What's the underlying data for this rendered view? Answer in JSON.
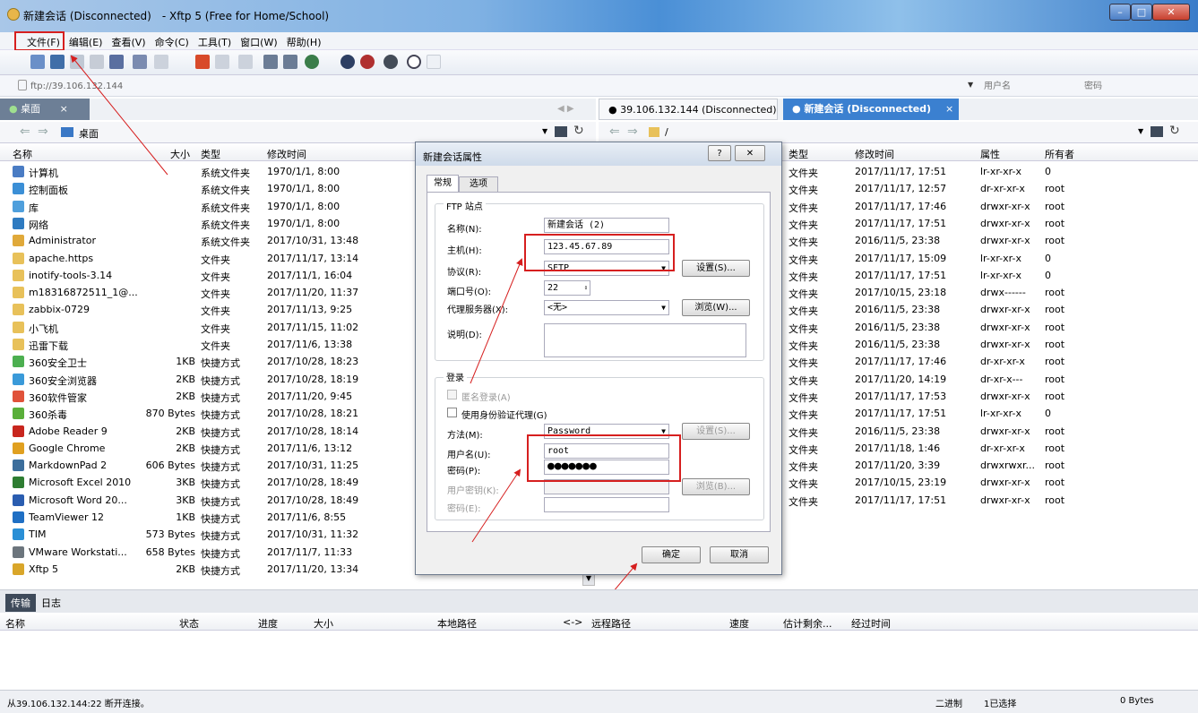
{
  "window": {
    "title": "新建会话 (Disconnected)　- Xftp 5 (Free for Home/School)",
    "min": "–",
    "max": "□",
    "close": "✕"
  },
  "menu": [
    "文件(F)",
    "编辑(E)",
    "查看(V)",
    "命令(C)",
    "工具(T)",
    "窗口(W)",
    "帮助(H)"
  ],
  "address": {
    "value": "ftp://39.106.132.144",
    "user_placeholder": "用户名",
    "pass_placeholder": "密码"
  },
  "left": {
    "tab": "桌面",
    "tab_close": "×",
    "path": "桌面",
    "columns": [
      "名称",
      "大小",
      "类型",
      "修改时间"
    ],
    "rows": [
      {
        "name": "计算机",
        "size": "",
        "type": "系统文件夹",
        "date": "1970/1/1, 8:00",
        "icon": "computer-icon",
        "color": "#4a7cc4"
      },
      {
        "name": "控制面板",
        "size": "",
        "type": "系统文件夹",
        "date": "1970/1/1, 8:00",
        "icon": "control-panel-icon",
        "color": "#3b8fd6"
      },
      {
        "name": "库",
        "size": "",
        "type": "系统文件夹",
        "date": "1970/1/1, 8:00",
        "icon": "library-icon",
        "color": "#4f9fdc"
      },
      {
        "name": "网络",
        "size": "",
        "type": "系统文件夹",
        "date": "1970/1/1, 8:00",
        "icon": "network-icon",
        "color": "#2f7bc1"
      },
      {
        "name": "Administrator",
        "size": "",
        "type": "系统文件夹",
        "date": "2017/10/31, 13:48",
        "icon": "user-folder-icon",
        "color": "#e0a93a"
      },
      {
        "name": "apache.https",
        "size": "",
        "type": "文件夹",
        "date": "2017/11/17, 13:14",
        "icon": "folder-icon",
        "color": "#e8c15a"
      },
      {
        "name": "inotify-tools-3.14",
        "size": "",
        "type": "文件夹",
        "date": "2017/11/1, 16:04",
        "icon": "folder-icon",
        "color": "#e8c15a"
      },
      {
        "name": "m18316872511_1@...",
        "size": "",
        "type": "文件夹",
        "date": "2017/11/20, 11:37",
        "icon": "folder-icon",
        "color": "#e8c15a"
      },
      {
        "name": "zabbix-0729",
        "size": "",
        "type": "文件夹",
        "date": "2017/11/13, 9:25",
        "icon": "folder-icon",
        "color": "#e8c15a"
      },
      {
        "name": "小飞机",
        "size": "",
        "type": "文件夹",
        "date": "2017/11/15, 11:02",
        "icon": "folder-icon",
        "color": "#e8c15a"
      },
      {
        "name": "迅雷下载",
        "size": "",
        "type": "文件夹",
        "date": "2017/11/6, 13:38",
        "icon": "folder-icon",
        "color": "#e8c15a"
      },
      {
        "name": "360安全卫士",
        "size": "1KB",
        "type": "快捷方式",
        "date": "2017/10/28, 18:23",
        "icon": "shortcut-icon",
        "color": "#4caf50"
      },
      {
        "name": "360安全浏览器",
        "size": "2KB",
        "type": "快捷方式",
        "date": "2017/10/28, 18:19",
        "icon": "shortcut-icon",
        "color": "#3a9ad9"
      },
      {
        "name": "360软件管家",
        "size": "2KB",
        "type": "快捷方式",
        "date": "2017/11/20, 9:45",
        "icon": "shortcut-icon",
        "color": "#e0523a"
      },
      {
        "name": "360杀毒",
        "size": "870 Bytes",
        "type": "快捷方式",
        "date": "2017/10/28, 18:21",
        "icon": "shortcut-icon",
        "color": "#5aaf3a"
      },
      {
        "name": "Adobe Reader 9",
        "size": "2KB",
        "type": "快捷方式",
        "date": "2017/10/28, 18:14",
        "icon": "shortcut-icon",
        "color": "#c8261e"
      },
      {
        "name": "Google Chrome",
        "size": "2KB",
        "type": "快捷方式",
        "date": "2017/11/6, 13:12",
        "icon": "shortcut-icon",
        "color": "#e0a020"
      },
      {
        "name": "MarkdownPad 2",
        "size": "606 Bytes",
        "type": "快捷方式",
        "date": "2017/10/31, 11:25",
        "icon": "shortcut-icon",
        "color": "#3c6e9c"
      },
      {
        "name": "Microsoft Excel 2010",
        "size": "3KB",
        "type": "快捷方式",
        "date": "2017/10/28, 18:49",
        "icon": "shortcut-icon",
        "color": "#2e7d32"
      },
      {
        "name": "Microsoft Word 20...",
        "size": "3KB",
        "type": "快捷方式",
        "date": "2017/10/28, 18:49",
        "icon": "shortcut-icon",
        "color": "#2a5db0"
      },
      {
        "name": "TeamViewer 12",
        "size": "1KB",
        "type": "快捷方式",
        "date": "2017/11/6, 8:55",
        "icon": "shortcut-icon",
        "color": "#1f6fc4"
      },
      {
        "name": "TIM",
        "size": "573 Bytes",
        "type": "快捷方式",
        "date": "2017/10/31, 11:32",
        "icon": "shortcut-icon",
        "color": "#2a8fd6"
      },
      {
        "name": "VMware Workstati...",
        "size": "658 Bytes",
        "type": "快捷方式",
        "date": "2017/11/7, 11:33",
        "icon": "shortcut-icon",
        "color": "#6c757d"
      },
      {
        "name": "Xftp 5",
        "size": "2KB",
        "type": "快捷方式",
        "date": "2017/11/20, 13:34",
        "icon": "shortcut-icon",
        "color": "#d9a62a"
      }
    ]
  },
  "right": {
    "tab1": "39.106.132.144 (Disconnected)",
    "tab2": "新建会话 (Disconnected)",
    "tab2_close": "×",
    "path": "/",
    "columns": [
      "类型",
      "修改时间",
      "属性",
      "所有者"
    ],
    "rows": [
      {
        "type": "文件夹",
        "date": "2017/11/17, 17:51",
        "attr": "lr-xr-xr-x",
        "owner": "0"
      },
      {
        "type": "文件夹",
        "date": "2017/11/17, 12:57",
        "attr": "dr-xr-xr-x",
        "owner": "root"
      },
      {
        "type": "文件夹",
        "date": "2017/11/17, 17:46",
        "attr": "drwxr-xr-x",
        "owner": "root"
      },
      {
        "type": "文件夹",
        "date": "2017/11/17, 17:51",
        "attr": "drwxr-xr-x",
        "owner": "root"
      },
      {
        "type": "文件夹",
        "date": "2016/11/5, 23:38",
        "attr": "drwxr-xr-x",
        "owner": "root"
      },
      {
        "type": "文件夹",
        "date": "2017/11/17, 15:09",
        "attr": "lr-xr-xr-x",
        "owner": "0"
      },
      {
        "type": "文件夹",
        "date": "2017/11/17, 17:51",
        "attr": "lr-xr-xr-x",
        "owner": "0"
      },
      {
        "type": "文件夹",
        "date": "2017/10/15, 23:18",
        "attr": "drwx------",
        "owner": "root"
      },
      {
        "type": "文件夹",
        "date": "2016/11/5, 23:38",
        "attr": "drwxr-xr-x",
        "owner": "root"
      },
      {
        "type": "文件夹",
        "date": "2016/11/5, 23:38",
        "attr": "drwxr-xr-x",
        "owner": "root"
      },
      {
        "type": "文件夹",
        "date": "2016/11/5, 23:38",
        "attr": "drwxr-xr-x",
        "owner": "root"
      },
      {
        "type": "文件夹",
        "date": "2017/11/17, 17:46",
        "attr": "dr-xr-xr-x",
        "owner": "root"
      },
      {
        "type": "文件夹",
        "date": "2017/11/20, 14:19",
        "attr": "dr-xr-x---",
        "owner": "root"
      },
      {
        "type": "文件夹",
        "date": "2017/11/17, 17:53",
        "attr": "drwxr-xr-x",
        "owner": "root"
      },
      {
        "type": "文件夹",
        "date": "2017/11/17, 17:51",
        "attr": "lr-xr-xr-x",
        "owner": "0"
      },
      {
        "type": "文件夹",
        "date": "2016/11/5, 23:38",
        "attr": "drwxr-xr-x",
        "owner": "root"
      },
      {
        "type": "文件夹",
        "date": "2017/11/18, 1:46",
        "attr": "dr-xr-xr-x",
        "owner": "root"
      },
      {
        "type": "文件夹",
        "date": "2017/11/20, 3:39",
        "attr": "drwxrwxr...",
        "owner": "root"
      },
      {
        "type": "文件夹",
        "date": "2017/10/15, 23:19",
        "attr": "drwxr-xr-x",
        "owner": "root"
      },
      {
        "type": "文件夹",
        "date": "2017/11/17, 17:51",
        "attr": "drwxr-xr-x",
        "owner": "root"
      }
    ]
  },
  "dialog": {
    "title": "新建会话属性",
    "help": "?",
    "close": "✕",
    "tab_general": "常规",
    "tab_options": "选项",
    "ftp_group": "FTP 站点",
    "name_label": "名称(N):",
    "name_value": "新建会话 (2)",
    "host_label": "主机(H):",
    "host_value": "123.45.67.89",
    "protocol_label": "协议(R):",
    "protocol_value": "SFTP",
    "settings_btn": "设置(S)...",
    "port_label": "端口号(O):",
    "port_value": "22",
    "proxy_label": "代理服务器(X):",
    "proxy_value": "<无>",
    "browse_btn": "浏览(W)...",
    "desc_label": "说明(D):",
    "login_group": "登录",
    "anon_label": "匿名登录(A)",
    "agent_label": "使用身份验证代理(G)",
    "method_label": "方法(M):",
    "method_value": "Password",
    "method_settings": "设置(S)...",
    "user_label": "用户名(U):",
    "user_value": "root",
    "pass_label": "密码(P):",
    "pass_value": "●●●●●●●",
    "key_label": "用户密钥(K):",
    "key_browse": "浏览(B)...",
    "passphrase_label": "密码(E):",
    "ok": "确定",
    "cancel": "取消"
  },
  "transfer": {
    "tab_transfer": "传输",
    "tab_log": "日志",
    "columns": [
      "名称",
      "状态",
      "进度",
      "大小",
      "本地路径",
      "<->",
      "远程路径",
      "速度",
      "估计剩余...",
      "经过时间"
    ]
  },
  "status": {
    "message": "从39.106.132.144:22 断开连接。",
    "mode": "二进制",
    "selected": "1已选择",
    "size": "0 Bytes"
  },
  "colors": {
    "highlight": "#d61f1f",
    "accent": "#2f6fc0"
  }
}
